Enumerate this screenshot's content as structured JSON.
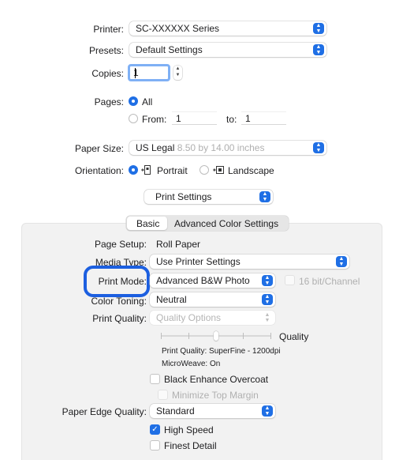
{
  "printer": {
    "label": "Printer:",
    "value": "SC-XXXXXX Series"
  },
  "presets": {
    "label": "Presets:",
    "value": "Default Settings"
  },
  "copies": {
    "label": "Copies:",
    "value": "1"
  },
  "pages": {
    "label": "Pages:",
    "all": "All",
    "from_label": "From:",
    "from_value": "1",
    "to_label": "to:",
    "to_value": "1",
    "selected": "All"
  },
  "paper_size": {
    "label": "Paper Size:",
    "value": "US Legal",
    "detail": "8.50 by 14.00 inches"
  },
  "orientation": {
    "label": "Orientation:",
    "portrait": "Portrait",
    "landscape": "Landscape",
    "selected": "Portrait"
  },
  "panel_select": {
    "value": "Print Settings"
  },
  "tabs": [
    {
      "label": "Basic",
      "selected": true
    },
    {
      "label": "Advanced Color Settings",
      "selected": false
    }
  ],
  "page_setup": {
    "label": "Page Setup:",
    "value": "Roll Paper"
  },
  "media_type": {
    "label": "Media Type:",
    "value": "Use Printer Settings"
  },
  "print_mode": {
    "label": "Print Mode:",
    "value": "Advanced B&W Photo",
    "option_16bit": "16 bit/Channel",
    "option_16bit_enabled": false
  },
  "color_toning": {
    "label": "Color Toning:",
    "value": "Neutral"
  },
  "print_quality": {
    "label": "Print Quality:",
    "value": "Quality Options",
    "enabled": false
  },
  "quality_slider": {
    "label": "Quality",
    "level_fraction": 0.5,
    "tick_count": 5
  },
  "quality_info": {
    "line1": "Print Quality: SuperFine - 1200dpi",
    "line2": "MicroWeave: On"
  },
  "options": {
    "black_enhance": "Black Enhance Overcoat",
    "black_enhance_checked": false,
    "minimize_margin": "Minimize Top Margin",
    "minimize_margin_enabled": false
  },
  "paper_edge_quality": {
    "label": "Paper Edge Quality:",
    "value": "Standard"
  },
  "high_speed": {
    "label": "High Speed",
    "checked": true
  },
  "finest_detail": {
    "label": "Finest Detail",
    "checked": false
  },
  "colors": {
    "accent": "#1f6fe5",
    "highlight_ring": "#1c5fe0",
    "panel_bg": "#f2f2f2"
  },
  "icons": {
    "popup": "updown-chevron-icon",
    "stepper": "stepper-icon",
    "portrait": "portrait-orientation-icon",
    "landscape": "landscape-orientation-icon"
  }
}
